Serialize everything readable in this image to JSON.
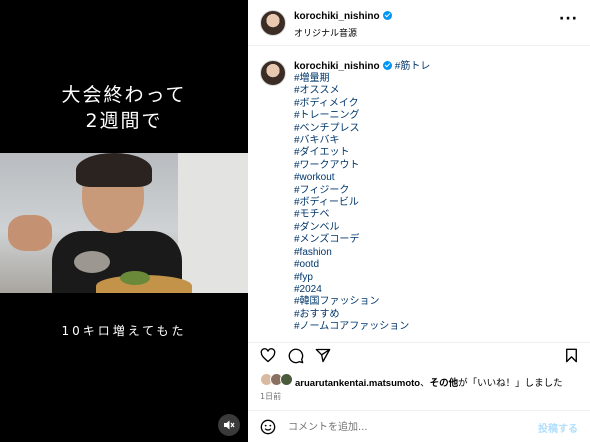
{
  "video": {
    "caption_line1": "大会終わって",
    "caption_line2": "2週間で",
    "caption_bottom": "10キロ増えてもた",
    "mute_icon": "speaker-muted-icon"
  },
  "header": {
    "username": "korochiki_nishino",
    "audio_label": "オリジナル音源",
    "more_icon": "more-horizontal-icon"
  },
  "post": {
    "username": "korochiki_nishino",
    "first_tag": "#筋トレ",
    "hashtags": [
      "#増量期",
      "#オススメ",
      "#ボディメイク",
      "#トレーニング",
      "#ベンチプレス",
      "#バキバキ",
      "#ダイエット",
      "#ワークアウト",
      "#workout",
      "#フィジーク",
      "#ボディービル",
      "#モチベ",
      "#ダンベル",
      "#メンズコーデ",
      "#fashion",
      "#ootd",
      "#fyp",
      "#2024",
      "#韓国ファッション",
      "#おすすめ",
      "#ノームコアファッション"
    ]
  },
  "likes": {
    "liker": "aruarutankentai.matsumoto",
    "separator": "、",
    "others": "その他",
    "suffix": "が「いいね！」しました"
  },
  "time_ago": "1日前",
  "comment": {
    "placeholder": "コメントを追加...",
    "post_label": "投稿する"
  },
  "colors": {
    "link": "#00376b",
    "verified": "#0095f6",
    "post_button_disabled": "#b2dffc"
  }
}
